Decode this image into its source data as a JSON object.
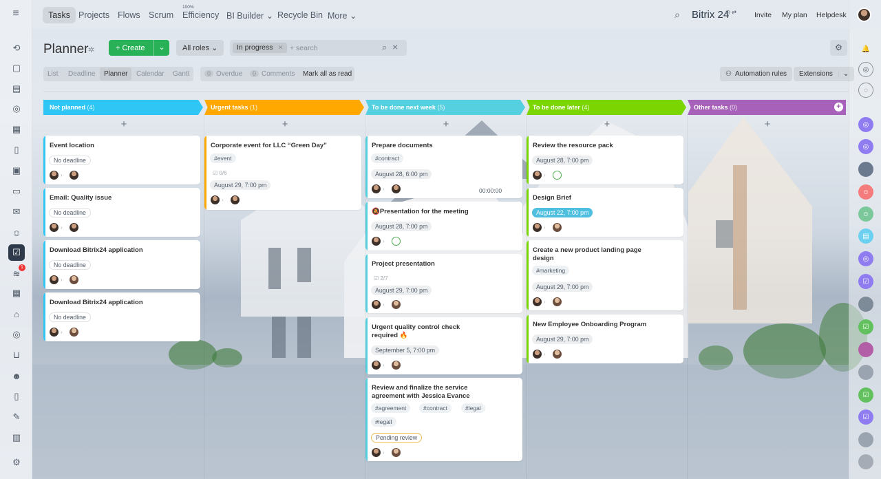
{
  "topnav": {
    "tabs": [
      {
        "label": "Tasks"
      },
      {
        "label": "Projects"
      },
      {
        "label": "Flows"
      },
      {
        "label": "Scrum"
      },
      {
        "label": "Efficiency",
        "sup": "100%"
      },
      {
        "label": "BI Builder ⌄"
      },
      {
        "label": "Recycle Bin"
      },
      {
        "label": "More ⌄"
      }
    ],
    "brand": "Bitrix 24",
    "invite": "Invite",
    "myplan": "My plan",
    "helpdesk": "Helpdesk"
  },
  "header": {
    "title": "Planner",
    "create": "+  Create",
    "roles": "All roles ⌄",
    "filter_chip": "In progress",
    "search_placeholder": "+ search"
  },
  "views": [
    "List",
    "Deadline",
    "Planner",
    "Calendar",
    "Gantt"
  ],
  "counters": {
    "overdue_n": "0",
    "overdue": "Overdue",
    "comments_n": "0",
    "comments": "Comments",
    "markread": "Mark all as read"
  },
  "right_actions": {
    "automation": "Automation rules",
    "extensions": "Extensions"
  },
  "colors": {
    "not_planned": "#2fc6f6",
    "urgent": "#ffa900",
    "next_week": "#55d0e0",
    "later": "#7bd500",
    "other": "#a861ba"
  },
  "columns": [
    {
      "title": "Not planned",
      "count": "(4)",
      "cards": [
        {
          "title": "Event location",
          "deadline": "No deadline"
        },
        {
          "title": "Email: Quality issue",
          "deadline": "No deadline"
        },
        {
          "title": "Download Bitrix24 application",
          "deadline": "No deadline"
        },
        {
          "title": "Download Bitrix24 application",
          "deadline": "No deadline"
        }
      ]
    },
    {
      "title": "Urgent tasks",
      "count": "(1)",
      "cards": [
        {
          "title": "Corporate event for LLC “Green Day”",
          "tag": "#event",
          "checklist": "0/6",
          "deadline": "August 29, 7:00 pm"
        }
      ]
    },
    {
      "title": "To be done next week",
      "count": "(5)",
      "cards": [
        {
          "title": "Prepare documents",
          "tag": "#contract",
          "deadline": "August 28, 6:00 pm",
          "timer": "00:00:00"
        },
        {
          "title": "Presentation for the meeting",
          "deadline": "August 28, 7:00 pm"
        },
        {
          "title": "Project presentation",
          "checklist": "2/7",
          "deadline": "August 29, 7:00 pm"
        },
        {
          "title": "Urgent quality control check required 🔥",
          "deadline": "September 5, 7:00 pm"
        },
        {
          "title": "Review and finalize the service agreement with Jessica Evance",
          "tags": [
            "#agreement",
            "#contract",
            "#legal",
            "#legall"
          ],
          "deadline": "Pending review"
        }
      ]
    },
    {
      "title": "To be done later",
      "count": "(4)",
      "cards": [
        {
          "title": "Review the resource pack",
          "deadline": "August 28, 7:00 pm"
        },
        {
          "title": "Design Brief",
          "deadline": "August 22, 7:00 pm"
        },
        {
          "title": "Create a new product landing page design",
          "tag": "#marketing",
          "deadline": "August 29, 7:00 pm"
        },
        {
          "title": "New Employee Onboarding Program",
          "deadline": "August 29, 7:00 pm"
        }
      ]
    },
    {
      "title": "Other tasks",
      "count": "(0)",
      "cards": []
    }
  ]
}
